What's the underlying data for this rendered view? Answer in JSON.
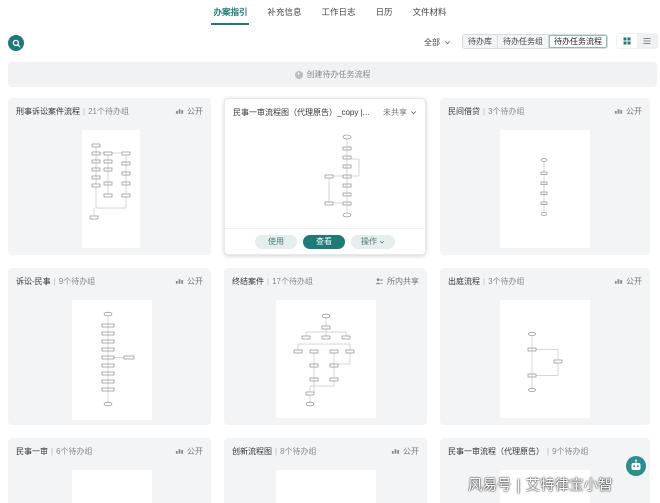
{
  "nav": {
    "tabs": [
      {
        "label": "办案指引",
        "active": true
      },
      {
        "label": "补充信息",
        "active": false
      },
      {
        "label": "工作日志",
        "active": false
      },
      {
        "label": "日历",
        "active": false
      },
      {
        "label": "文件材料",
        "active": false
      }
    ]
  },
  "toolbar": {
    "search_icon": "search-icon",
    "filter_label": "全部",
    "segments": [
      {
        "label": "待办库",
        "active": false
      },
      {
        "label": "待办任务组",
        "active": false
      },
      {
        "label": "待办任务流程",
        "active": true
      }
    ],
    "view_icons": [
      "grid-view-icon",
      "list-view-icon"
    ]
  },
  "create": {
    "label": "创建待办任务流程"
  },
  "cards": [
    {
      "title": "刑事诉讼案件流程",
      "count": "21个待办组",
      "share": "公开"
    },
    {
      "title": "民事一审流程图（代理原告）_copy |...",
      "count": "",
      "share": "未共享",
      "hover": true,
      "actions": {
        "use": "使用",
        "view": "查看",
        "ops": "操作"
      }
    },
    {
      "title": "民间借贷",
      "count": "3个待办组",
      "share": "公开"
    },
    {
      "title": "诉讼-民事",
      "count": "9个待办组",
      "share": "公开"
    },
    {
      "title": "终结案件",
      "count": "17个待办组",
      "share": "所内共享"
    },
    {
      "title": "出庭流程",
      "count": "3个待办组",
      "share": "公开"
    },
    {
      "title": "民事一审",
      "count": "6个待办组",
      "share": "公开"
    },
    {
      "title": "创新流程图",
      "count": "8个待办组",
      "share": "公开"
    },
    {
      "title": "民事一审流程（代理原告）",
      "count": "9个待办组",
      "share": ""
    }
  ],
  "watermark": "风易号 | 艾特律宝小智",
  "colors": {
    "accent": "#1e7a78",
    "card_bg": "#f3f4f5"
  }
}
